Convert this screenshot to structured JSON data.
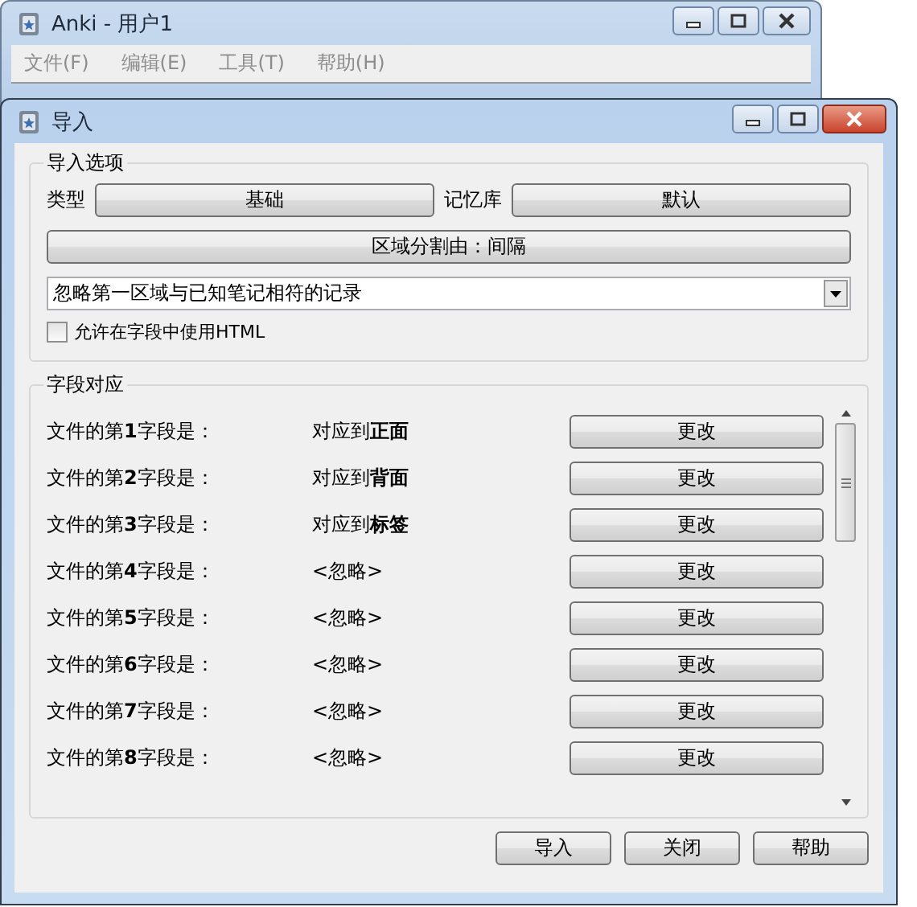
{
  "main_window": {
    "title": "Anki - 用户1",
    "menu": [
      "文件(F)",
      "编辑(E)",
      "工具(T)",
      "帮助(H)"
    ]
  },
  "dialog": {
    "title": "导入",
    "options_group": {
      "title": "导入选项",
      "type_label": "类型",
      "type_button": "基础",
      "deck_label": "记忆库",
      "deck_button": "默认",
      "separator_button": "区域分割由：间隔",
      "mode_dropdown": {
        "value": "忽略第一区域与已知笔记相符的记录"
      },
      "allow_html": {
        "label": "允许在字段中使用HTML",
        "checked": false
      }
    },
    "fields_group": {
      "title": "字段对应",
      "rows": [
        {
          "label": "文件的第**1**字段是：",
          "mapping": "对应到**正面**",
          "button": "更改"
        },
        {
          "label": "文件的第**2**字段是：",
          "mapping": "对应到**背面**",
          "button": "更改"
        },
        {
          "label": "文件的第**3**字段是：",
          "mapping": "对应到**标签**",
          "button": "更改"
        },
        {
          "label": "文件的第**4**字段是：",
          "mapping": "<忽略>",
          "button": "更改"
        },
        {
          "label": "文件的第**5**字段是：",
          "mapping": "<忽略>",
          "button": "更改"
        },
        {
          "label": "文件的第**6**字段是：",
          "mapping": "<忽略>",
          "button": "更改"
        },
        {
          "label": "文件的第**7**字段是：",
          "mapping": "<忽略>",
          "button": "更改"
        },
        {
          "label": "文件的第**8**字段是：",
          "mapping": "<忽略>",
          "button": "更改"
        }
      ]
    },
    "buttons": [
      "导入",
      "关闭",
      "帮助"
    ]
  }
}
